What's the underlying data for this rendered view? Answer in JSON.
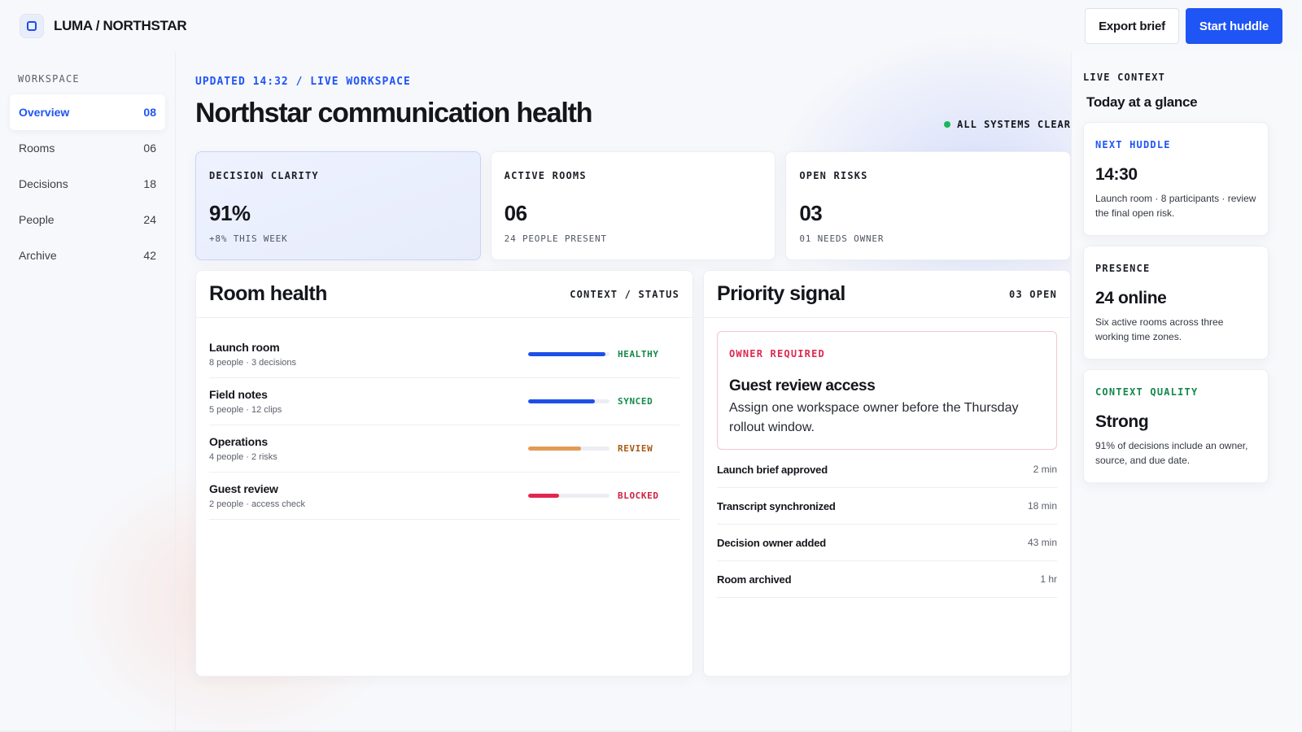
{
  "brand": {
    "name": "LUMA / NORTHSTAR"
  },
  "actions": {
    "export_label": "Export brief",
    "start_label": "Start huddle"
  },
  "sidebar": {
    "heading": "WORKSPACE",
    "items": [
      {
        "label": "Overview",
        "count": "08"
      },
      {
        "label": "Rooms",
        "count": "06"
      },
      {
        "label": "Decisions",
        "count": "18"
      },
      {
        "label": "People",
        "count": "24"
      },
      {
        "label": "Archive",
        "count": "42"
      }
    ]
  },
  "main": {
    "updated": "UPDATED 14:32 / LIVE WORKSPACE",
    "title": "Northstar communication health",
    "status": "ALL SYSTEMS CLEAR",
    "kpis": [
      {
        "label": "DECISION CLARITY",
        "value": "91%",
        "sub": "+8% THIS WEEK"
      },
      {
        "label": "ACTIVE ROOMS",
        "value": "06",
        "sub": "24 PEOPLE PRESENT"
      },
      {
        "label": "OPEN RISKS",
        "value": "03",
        "sub": "01 NEEDS OWNER"
      }
    ]
  },
  "room_health": {
    "title": "Room health",
    "meta": "CONTEXT / STATUS",
    "rooms": [
      {
        "name": "Launch room",
        "meta": "8 people · 3 decisions",
        "level": 0.95,
        "state": "HEALTHY",
        "color": "#1f4fe8",
        "state_color": "#15894a"
      },
      {
        "name": "Field notes",
        "meta": "5 people · 12 clips",
        "level": 0.82,
        "state": "SYNCED",
        "color": "#1f4fe8",
        "state_color": "#15894a"
      },
      {
        "name": "Operations",
        "meta": "4 people · 2 risks",
        "level": 0.65,
        "state": "REVIEW",
        "color": "#e39a55",
        "state_color": "#a85a14"
      },
      {
        "name": "Guest review",
        "meta": "2 people · access check",
        "level": 0.38,
        "state": "BLOCKED",
        "color": "#e0284f",
        "state_color": "#d0213f"
      }
    ]
  },
  "priority": {
    "title": "Priority signal",
    "meta": "03 OPEN",
    "alert": {
      "tag": "OWNER REQUIRED",
      "title": "Guest review access",
      "body": "Assign one workspace owner before the Thursday rollout window."
    },
    "events": [
      {
        "name": "Launch brief approved",
        "time": "2 min"
      },
      {
        "name": "Transcript synchronized",
        "time": "18 min"
      },
      {
        "name": "Decision owner added",
        "time": "43 min"
      },
      {
        "name": "Room archived",
        "time": "1 hr"
      }
    ]
  },
  "rail": {
    "heading": "LIVE CONTEXT",
    "title": "Today at a glance",
    "cards": [
      {
        "tag": "NEXT HUDDLE",
        "value": "14:30",
        "text": "Launch room · 8 participants · review the final open risk.",
        "color": "#1f55f5"
      },
      {
        "tag": "PRESENCE",
        "value": "24 online",
        "text": "Six active rooms across three working time zones.",
        "color": "#1c1f26"
      },
      {
        "tag": "CONTEXT QUALITY",
        "value": "Strong",
        "text": "91% of decisions include an owner, source, and due date.",
        "color": "#15894a"
      }
    ]
  }
}
